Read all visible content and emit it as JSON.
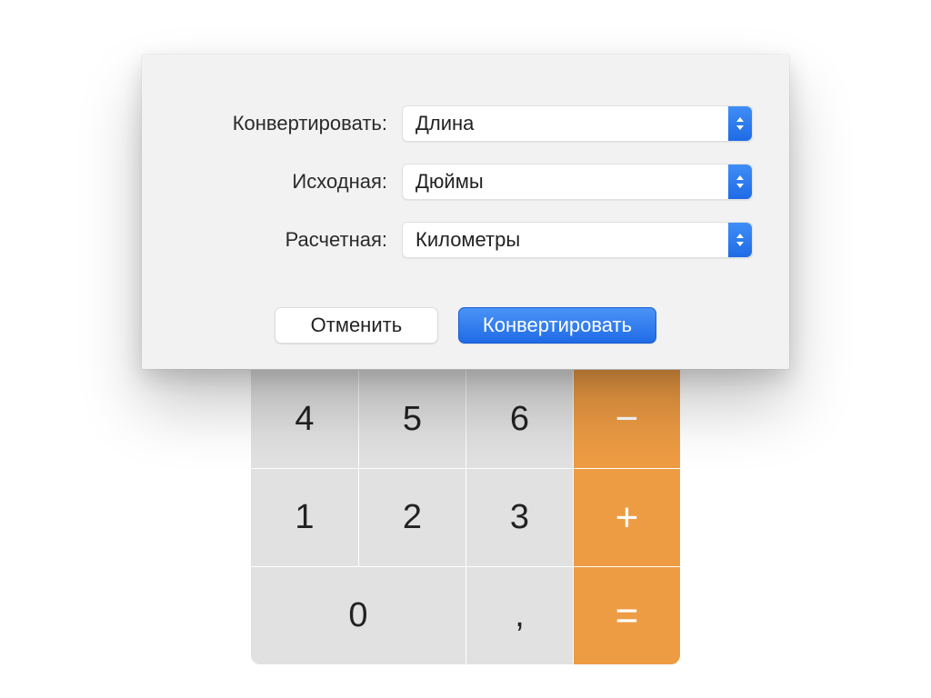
{
  "dialog": {
    "rows": [
      {
        "label": "Конвертировать:",
        "value": "Длина"
      },
      {
        "label": "Исходная:",
        "value": "Дюймы"
      },
      {
        "label": "Расчетная:",
        "value": "Километры"
      }
    ],
    "cancel": "Отменить",
    "confirm": "Конвертировать"
  },
  "calc": {
    "keys": {
      "k4": "4",
      "k5": "5",
      "k6": "6",
      "minus": "−",
      "k1": "1",
      "k2": "2",
      "k3": "3",
      "plus": "+",
      "k0": "0",
      "dec": ",",
      "eq": "="
    }
  },
  "colors": {
    "accent": "#ee9c44",
    "primary": "#1f6be6"
  }
}
